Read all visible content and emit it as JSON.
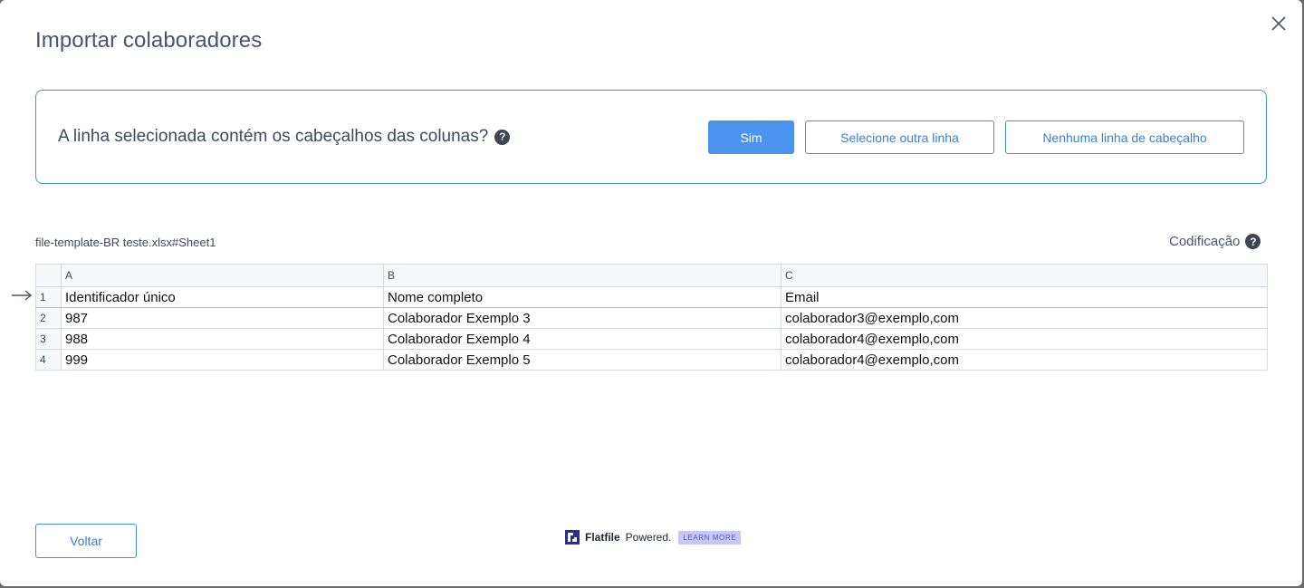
{
  "dialog": {
    "title": "Importar colaboradores",
    "close_icon": "close-icon"
  },
  "header_prompt": {
    "question": "A linha selecionada contém os cabeçalhos das colunas?",
    "help": "?",
    "yes_label": "Sim",
    "select_other_label": "Selecione outra linha",
    "no_header_label": "Nenhuma linha de cabeçalho"
  },
  "file": {
    "name": "file-template-BR teste.xlsx#Sheet1",
    "encoding_label": "Codificação",
    "encoding_help": "?"
  },
  "sheet": {
    "columns": [
      "A",
      "B",
      "C"
    ],
    "rows": [
      {
        "num": "1",
        "cells": [
          "Identificador único",
          "Nome completo",
          "Email"
        ]
      },
      {
        "num": "2",
        "cells": [
          "987",
          "Colaborador Exemplo 3",
          "colaborador3@exemplo,com"
        ]
      },
      {
        "num": "3",
        "cells": [
          "988",
          "Colaborador Exemplo 4",
          "colaborador4@exemplo,com"
        ]
      },
      {
        "num": "4",
        "cells": [
          "999",
          "Colaborador Exemplo 5",
          "colaborador4@exemplo,com"
        ]
      }
    ],
    "selected_row_icon": "arrow-right-icon"
  },
  "footer": {
    "back_label": "Voltar",
    "brand": "Flatfile",
    "powered": "Powered.",
    "learn_more": "LEARN MORE"
  },
  "colors": {
    "primary": "#4a94ee",
    "border_accent": "#4a90e2",
    "learn_badge_bg": "#c8c6f2"
  }
}
